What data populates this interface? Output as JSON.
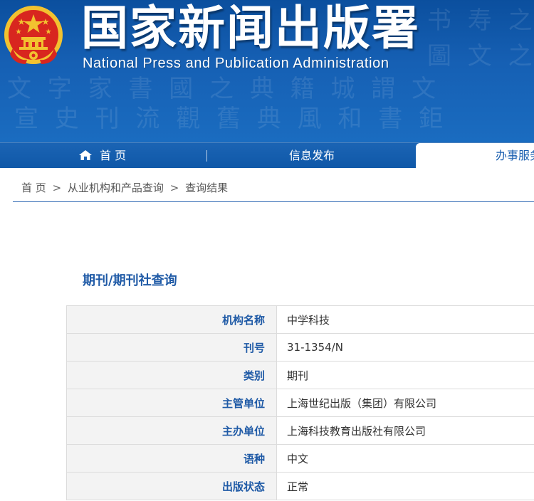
{
  "header": {
    "title_cn": "国家新闻出版署",
    "title_en": "National  Press and Publication Administration"
  },
  "nav": {
    "home": "首 页",
    "info": "信息发布",
    "service": "办事服务"
  },
  "breadcrumb": {
    "home": "首 页",
    "sep": ">",
    "level2": "从业机构和产品查询",
    "current": "查询结果"
  },
  "section": {
    "title": "期刊/期刊社查询"
  },
  "table": {
    "rows": [
      {
        "label": "机构名称",
        "value": "中学科技"
      },
      {
        "label": "刊号",
        "value": "31-1354/N"
      },
      {
        "label": "类别",
        "value": "期刊"
      },
      {
        "label": "主管单位",
        "value": "上海世纪出版（集团）有限公司"
      },
      {
        "label": "主办单位",
        "value": "上海科技教育出版社有限公司"
      },
      {
        "label": "语种",
        "value": "中文"
      },
      {
        "label": "出版状态",
        "value": "正常"
      }
    ]
  },
  "colors": {
    "banner": "#1660b4",
    "nav": "#1560b0",
    "accent": "#1f5aa6",
    "emblem_red": "#d8261f",
    "emblem_gold": "#f2c230"
  },
  "icons": {
    "emblem": "national-emblem-icon",
    "home": "home-icon"
  }
}
